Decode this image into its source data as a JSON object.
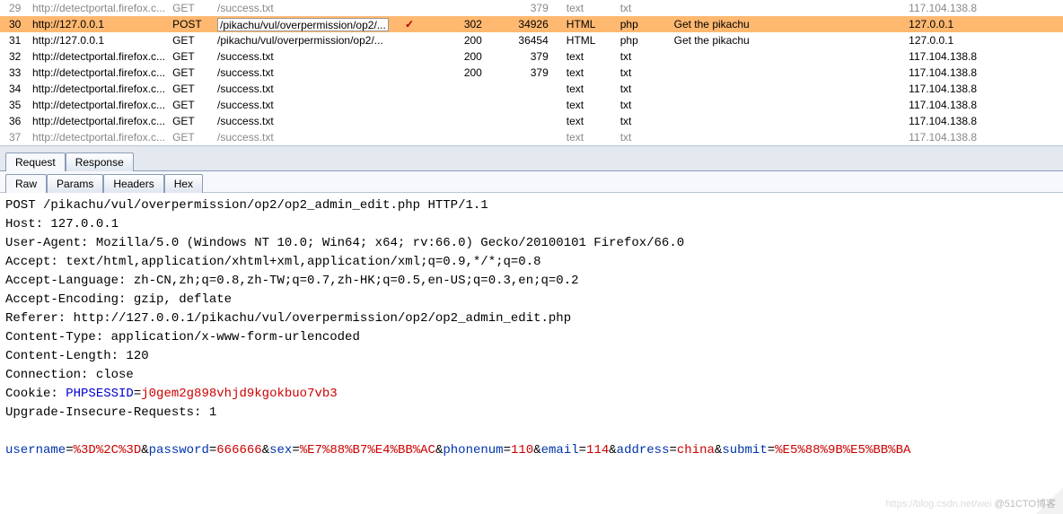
{
  "rows": [
    {
      "n": "29",
      "host": "http://detectportal.firefox.c...",
      "m": "GET",
      "path": "/success.txt",
      "chk": "",
      "status": "",
      "len": "379",
      "mime": "text",
      "ext": "txt",
      "title": "",
      "ip": "117.104.138.8",
      "cls": "cut"
    },
    {
      "n": "30",
      "host": "http://127.0.0.1",
      "m": "POST",
      "path": "/pikachu/vul/overpermission/op2/...",
      "chk": "✓",
      "status": "302",
      "len": "34926",
      "mime": "HTML",
      "ext": "php",
      "title": "Get the pikachu",
      "ip": "127.0.0.1",
      "cls": "sel"
    },
    {
      "n": "31",
      "host": "http://127.0.0.1",
      "m": "GET",
      "path": "/pikachu/vul/overpermission/op2/...",
      "chk": "",
      "status": "200",
      "len": "36454",
      "mime": "HTML",
      "ext": "php",
      "title": "Get the pikachu",
      "ip": "127.0.0.1",
      "cls": ""
    },
    {
      "n": "32",
      "host": "http://detectportal.firefox.c...",
      "m": "GET",
      "path": "/success.txt",
      "chk": "",
      "status": "200",
      "len": "379",
      "mime": "text",
      "ext": "txt",
      "title": "",
      "ip": "117.104.138.8",
      "cls": ""
    },
    {
      "n": "33",
      "host": "http://detectportal.firefox.c...",
      "m": "GET",
      "path": "/success.txt",
      "chk": "",
      "status": "200",
      "len": "379",
      "mime": "text",
      "ext": "txt",
      "title": "",
      "ip": "117.104.138.8",
      "cls": ""
    },
    {
      "n": "34",
      "host": "http://detectportal.firefox.c...",
      "m": "GET",
      "path": "/success.txt",
      "chk": "",
      "status": "",
      "len": "",
      "mime": "text",
      "ext": "txt",
      "title": "",
      "ip": "117.104.138.8",
      "cls": ""
    },
    {
      "n": "35",
      "host": "http://detectportal.firefox.c...",
      "m": "GET",
      "path": "/success.txt",
      "chk": "",
      "status": "",
      "len": "",
      "mime": "text",
      "ext": "txt",
      "title": "",
      "ip": "117.104.138.8",
      "cls": ""
    },
    {
      "n": "36",
      "host": "http://detectportal.firefox.c...",
      "m": "GET",
      "path": "/success.txt",
      "chk": "",
      "status": "",
      "len": "",
      "mime": "text",
      "ext": "txt",
      "title": "",
      "ip": "117.104.138.8",
      "cls": ""
    },
    {
      "n": "37",
      "host": "http://detectportal.firefox.c...",
      "m": "GET",
      "path": "/success.txt",
      "chk": "",
      "status": "",
      "len": "",
      "mime": "text",
      "ext": "txt",
      "title": "",
      "ip": "117.104.138.8",
      "cls": "cut"
    }
  ],
  "mainTabs": {
    "t0": "Request",
    "t1": "Response"
  },
  "subTabs": {
    "s0": "Raw",
    "s1": "Params",
    "s2": "Headers",
    "s3": "Hex"
  },
  "req": {
    "l0": "POST /pikachu/vul/overpermission/op2/op2_admin_edit.php HTTP/1.1",
    "l1": "Host: 127.0.0.1",
    "l2": "User-Agent: Mozilla/5.0 (Windows NT 10.0; Win64; x64; rv:66.0) Gecko/20100101 Firefox/66.0",
    "l3": "Accept: text/html,application/xhtml+xml,application/xml;q=0.9,*/*;q=0.8",
    "l4": "Accept-Language: zh-CN,zh;q=0.8,zh-TW;q=0.7,zh-HK;q=0.5,en-US;q=0.3,en;q=0.2",
    "l5": "Accept-Encoding: gzip, deflate",
    "l6": "Referer: http://127.0.0.1/pikachu/vul/overpermission/op2/op2_admin_edit.php",
    "l7": "Content-Type: application/x-www-form-urlencoded",
    "l8": "Content-Length: 120",
    "l9": "Connection: close",
    "cookieK": "Cookie: ",
    "sessK": "PHPSESSID",
    "sessV": "j0gem2g898vhjd9kgokbuo7vb3",
    "l11": "Upgrade-Insecure-Requests: 1",
    "p": {
      "k1": "username",
      "v1": "%3D%2C%3D",
      "k2": "password",
      "v2": "666666",
      "k3": "sex",
      "v3": "%E7%88%B7%E4%BB%AC",
      "k4": "phonenum",
      "v4": "110",
      "k5": "email",
      "v5": "114",
      "k6": "address",
      "v6": "china",
      "k7": "submit",
      "v7": "%E5%88%9B%E5%BB%BA"
    }
  },
  "water": {
    "faint": "https://blog.csdn.net/wei",
    "handle": "@51CTO博客"
  }
}
